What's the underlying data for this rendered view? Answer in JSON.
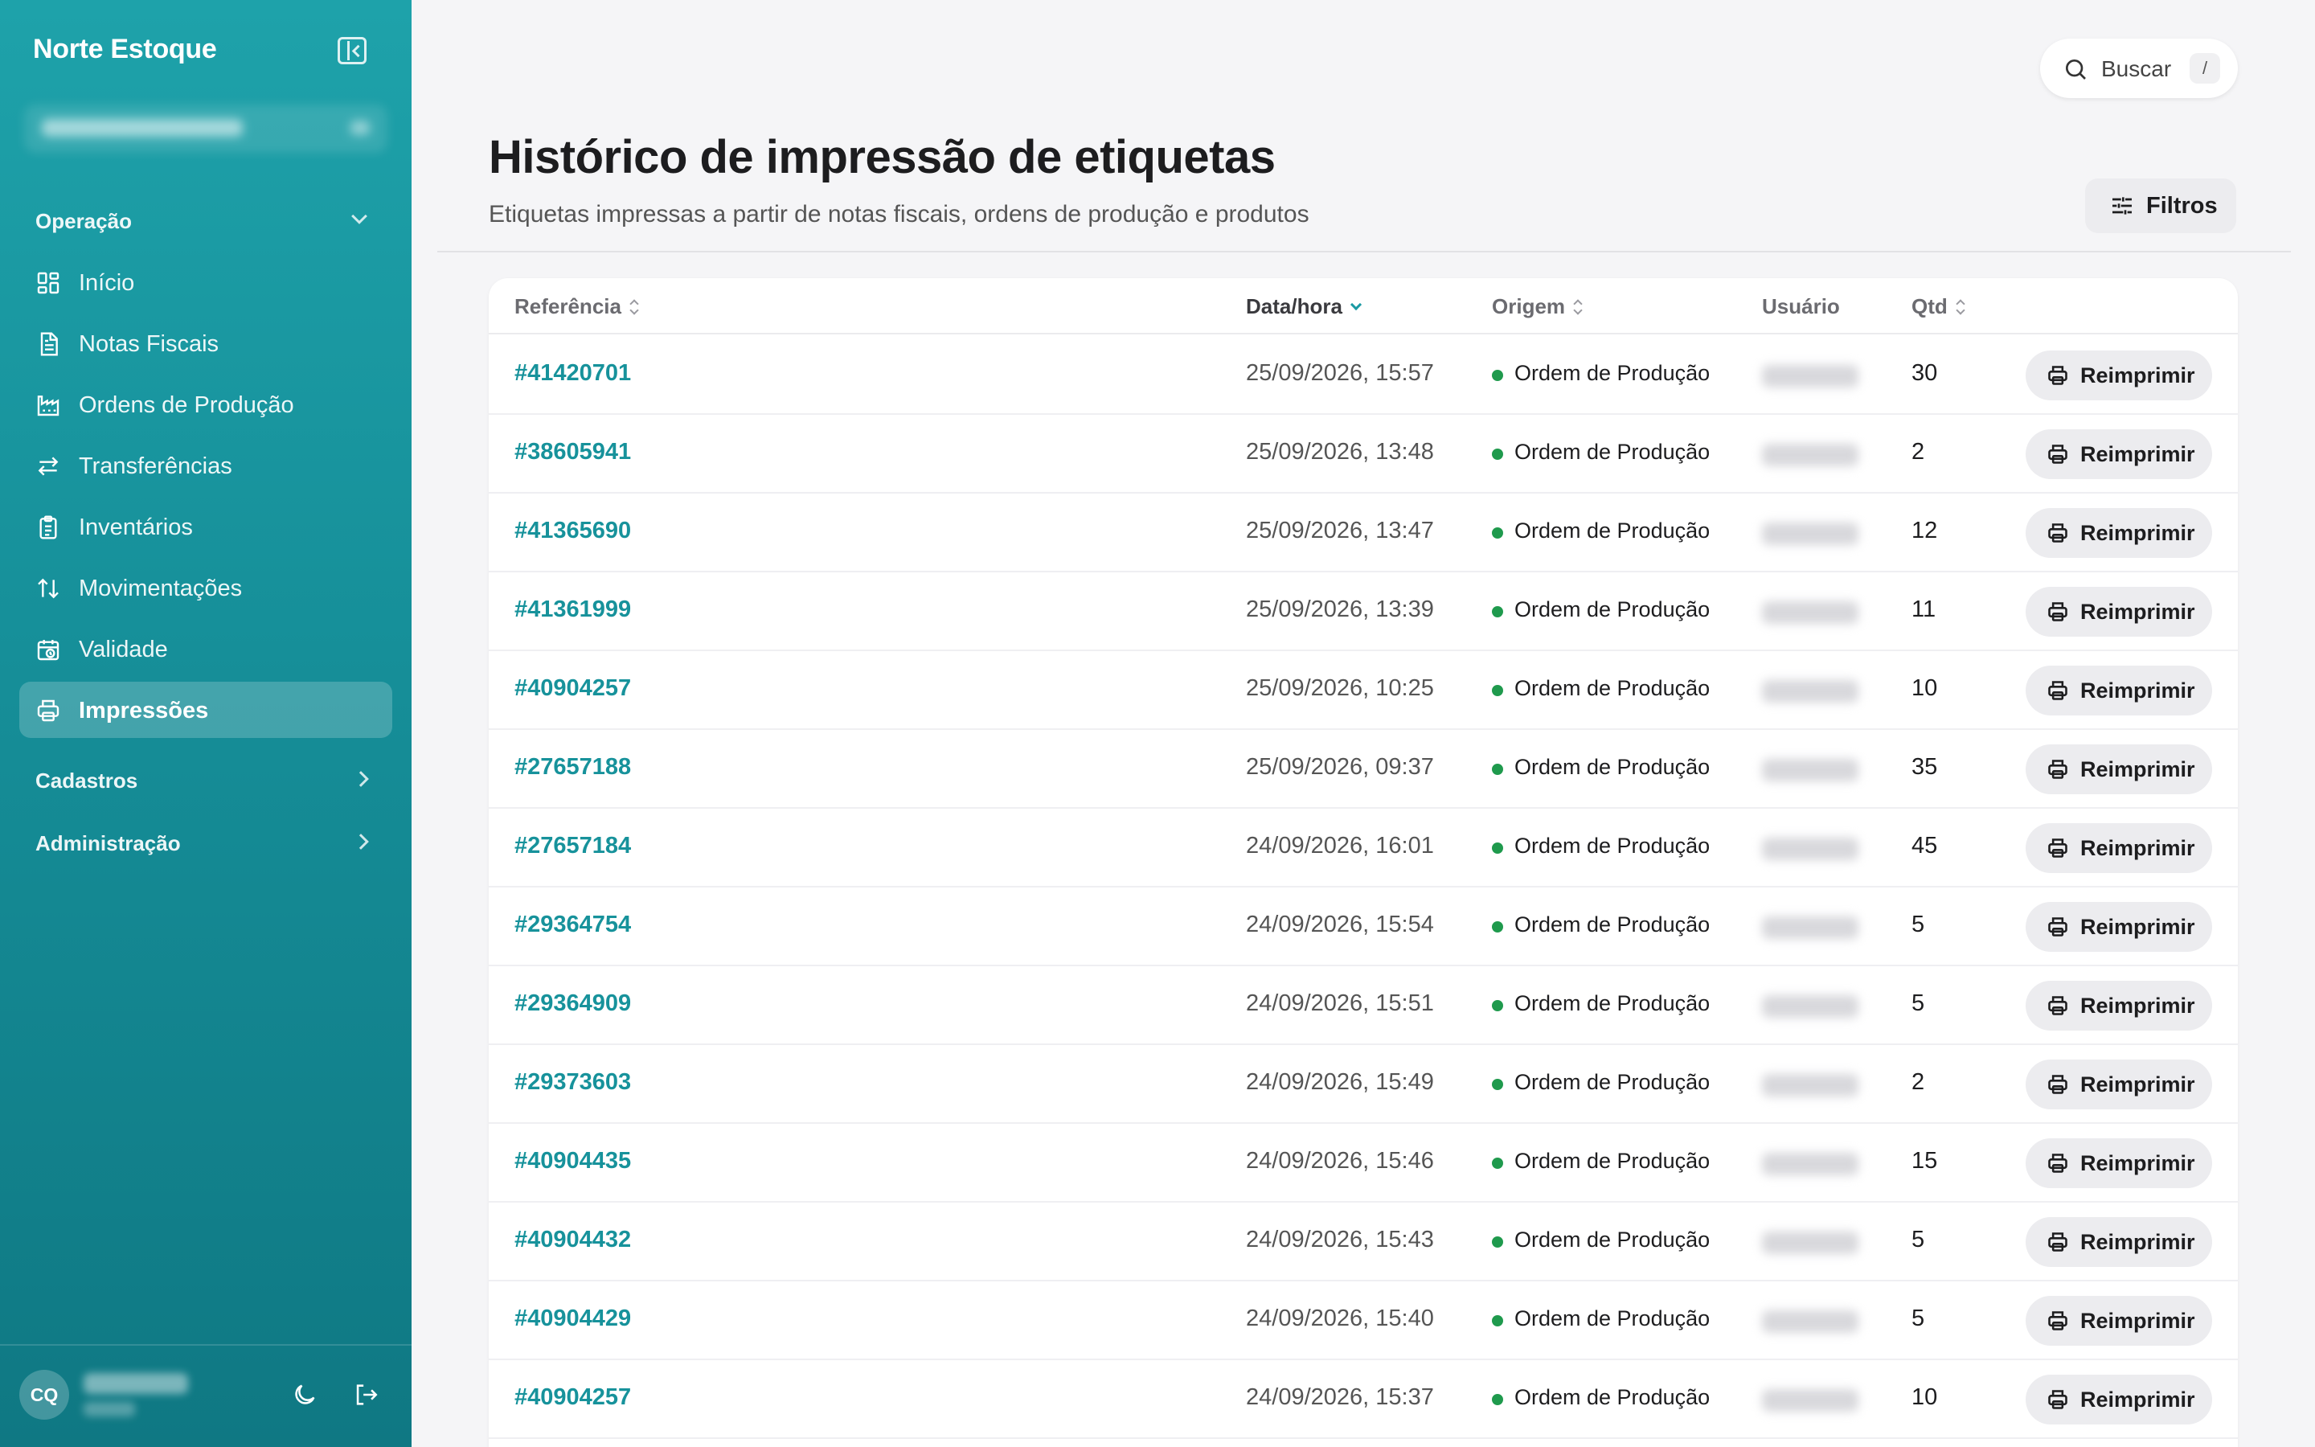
{
  "sidebar": {
    "brand": "Norte Estoque",
    "sections": {
      "operacao": "Operação",
      "cadastros": "Cadastros",
      "administracao": "Administração"
    },
    "items": [
      {
        "label": "Início",
        "icon": "grid-icon"
      },
      {
        "label": "Notas Fiscais",
        "icon": "document-icon"
      },
      {
        "label": "Ordens de Produção",
        "icon": "factory-icon"
      },
      {
        "label": "Transferências",
        "icon": "arrows-swap-icon"
      },
      {
        "label": "Inventários",
        "icon": "clipboard-icon"
      },
      {
        "label": "Movimentações",
        "icon": "arrows-updown-icon"
      },
      {
        "label": "Validade",
        "icon": "calendar-clock-icon"
      },
      {
        "label": "Impressões",
        "icon": "printer-icon",
        "active": true
      }
    ],
    "user": {
      "initials": "CQ"
    }
  },
  "search": {
    "label": "Buscar",
    "shortcut": "/"
  },
  "header": {
    "title": "Histórico de impressão de etiquetas",
    "subtitle": "Etiquetas impressas a partir de notas fiscais, ordens de produção e produtos",
    "filter_label": "Filtros"
  },
  "table": {
    "columns": {
      "referencia": "Referência",
      "data_hora": "Data/hora",
      "origem": "Origem",
      "usuario": "Usuário",
      "qtd": "Qtd"
    },
    "action_label": "Reimprimir",
    "rows": [
      {
        "ref": "#41420701",
        "datetime": "25/09/2026, 15:57",
        "origin": "Ordem de Produção",
        "qty": "30"
      },
      {
        "ref": "#38605941",
        "datetime": "25/09/2026, 13:48",
        "origin": "Ordem de Produção",
        "qty": "2"
      },
      {
        "ref": "#41365690",
        "datetime": "25/09/2026, 13:47",
        "origin": "Ordem de Produção",
        "qty": "12"
      },
      {
        "ref": "#41361999",
        "datetime": "25/09/2026, 13:39",
        "origin": "Ordem de Produção",
        "qty": "11"
      },
      {
        "ref": "#40904257",
        "datetime": "25/09/2026, 10:25",
        "origin": "Ordem de Produção",
        "qty": "10"
      },
      {
        "ref": "#27657188",
        "datetime": "25/09/2026, 09:37",
        "origin": "Ordem de Produção",
        "qty": "35"
      },
      {
        "ref": "#27657184",
        "datetime": "24/09/2026, 16:01",
        "origin": "Ordem de Produção",
        "qty": "45"
      },
      {
        "ref": "#29364754",
        "datetime": "24/09/2026, 15:54",
        "origin": "Ordem de Produção",
        "qty": "5"
      },
      {
        "ref": "#29364909",
        "datetime": "24/09/2026, 15:51",
        "origin": "Ordem de Produção",
        "qty": "5"
      },
      {
        "ref": "#29373603",
        "datetime": "24/09/2026, 15:49",
        "origin": "Ordem de Produção",
        "qty": "2"
      },
      {
        "ref": "#40904435",
        "datetime": "24/09/2026, 15:46",
        "origin": "Ordem de Produção",
        "qty": "15"
      },
      {
        "ref": "#40904432",
        "datetime": "24/09/2026, 15:43",
        "origin": "Ordem de Produção",
        "qty": "5"
      },
      {
        "ref": "#40904429",
        "datetime": "24/09/2026, 15:40",
        "origin": "Ordem de Produção",
        "qty": "5"
      },
      {
        "ref": "#40904257",
        "datetime": "24/09/2026, 15:37",
        "origin": "Ordem de Produção",
        "qty": "10"
      }
    ]
  },
  "colors": {
    "accent": "#17929b",
    "status_green": "#1f9a4d",
    "sidebar_top": "#1ea2aa",
    "sidebar_bottom": "#0f7883"
  }
}
